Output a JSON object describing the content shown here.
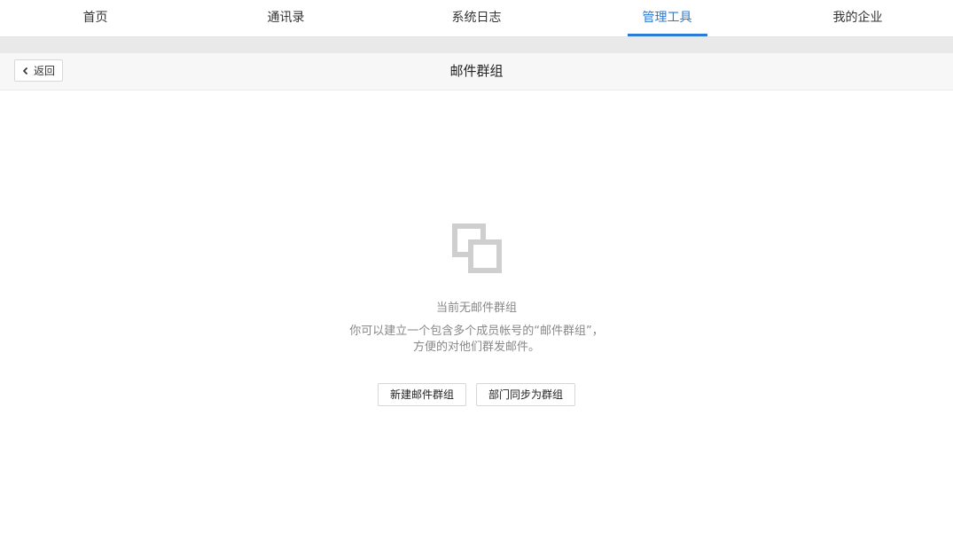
{
  "nav": {
    "tabs": [
      {
        "label": "首页",
        "active": false
      },
      {
        "label": "通讯录",
        "active": false
      },
      {
        "label": "系统日志",
        "active": false
      },
      {
        "label": "管理工具",
        "active": true
      },
      {
        "label": "我的企业",
        "active": false
      }
    ],
    "active_color": "#2a7ad6"
  },
  "subheader": {
    "back_label": "返回",
    "back_icon": "chevron-left-icon",
    "title": "邮件群组"
  },
  "empty": {
    "icon": "overlapping-squares-icon",
    "title": "当前无邮件群组",
    "desc_line1": "你可以建立一个包含多个成员帐号的“邮件群组”，",
    "desc_line2": "方便的对他们群发邮件。"
  },
  "actions": {
    "new_group_label": "新建邮件群组",
    "sync_label": "部门同步为群组"
  }
}
